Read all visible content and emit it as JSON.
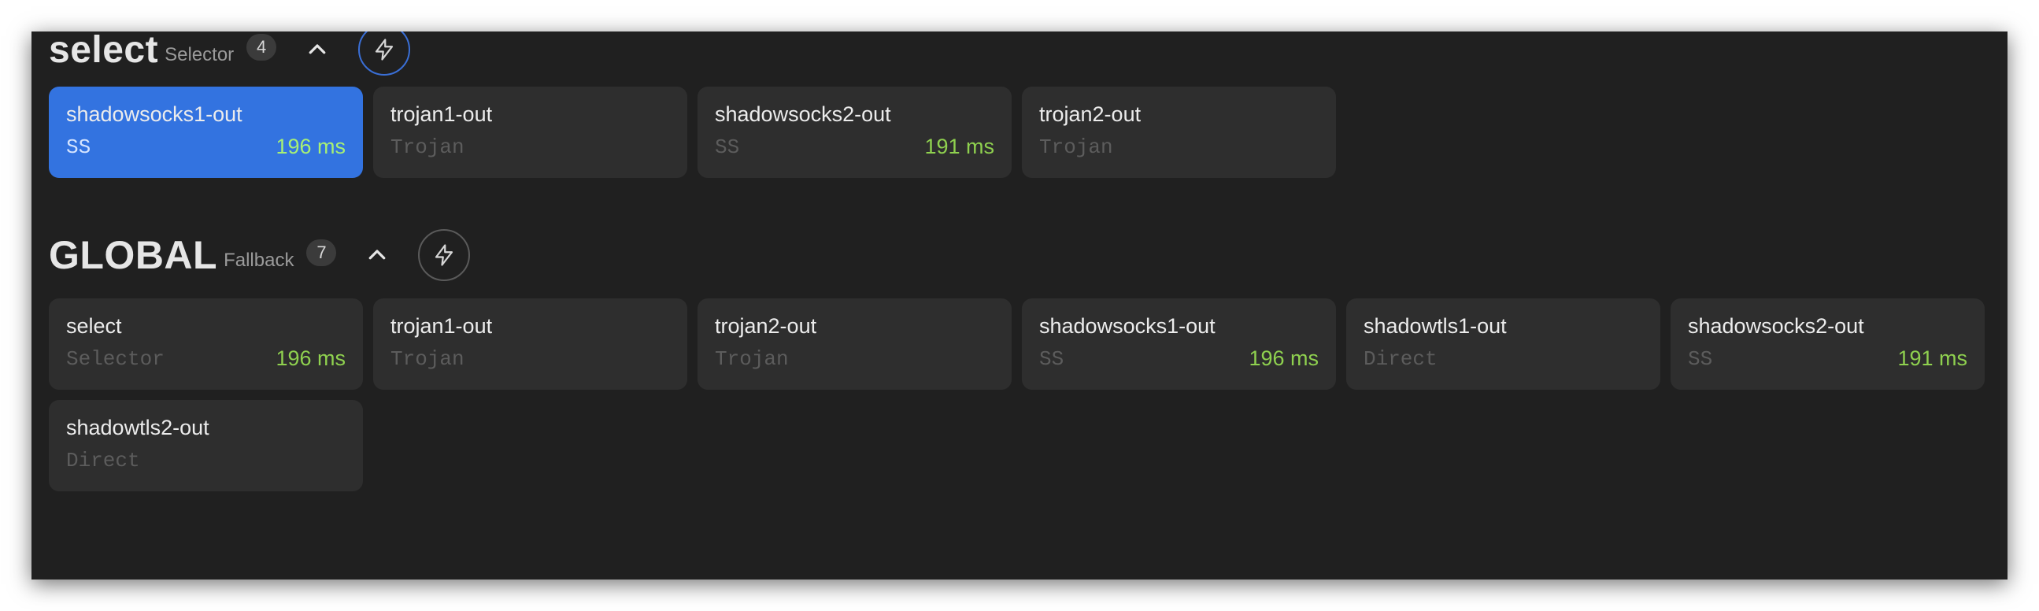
{
  "groups": [
    {
      "name": "select",
      "type": "Selector",
      "count": "4",
      "proxies": [
        {
          "name": "shadowsocks1-out",
          "type": "SS",
          "latency": "196 ms",
          "selected": true
        },
        {
          "name": "trojan1-out",
          "type": "Trojan",
          "latency": "",
          "selected": false
        },
        {
          "name": "shadowsocks2-out",
          "type": "SS",
          "latency": "191 ms",
          "selected": false
        },
        {
          "name": "trojan2-out",
          "type": "Trojan",
          "latency": "",
          "selected": false
        }
      ]
    },
    {
      "name": "GLOBAL",
      "type": "Fallback",
      "count": "7",
      "proxies": [
        {
          "name": "select",
          "type": "Selector",
          "latency": "196 ms",
          "selected": false
        },
        {
          "name": "trojan1-out",
          "type": "Trojan",
          "latency": "",
          "selected": false
        },
        {
          "name": "trojan2-out",
          "type": "Trojan",
          "latency": "",
          "selected": false
        },
        {
          "name": "shadowsocks1-out",
          "type": "SS",
          "latency": "196 ms",
          "selected": false
        },
        {
          "name": "shadowtls1-out",
          "type": "Direct",
          "latency": "",
          "selected": false
        },
        {
          "name": "shadowsocks2-out",
          "type": "SS",
          "latency": "191 ms",
          "selected": false
        },
        {
          "name": "shadowtls2-out",
          "type": "Direct",
          "latency": "",
          "selected": false
        }
      ]
    }
  ],
  "icons": {
    "collapse": "chevron-up-icon",
    "latency_test": "lightning-bolt-icon"
  },
  "colors": {
    "selected_card": "#3373e0",
    "latency": "#8fd14f",
    "background": "#202020",
    "card": "#2e2e2e"
  }
}
